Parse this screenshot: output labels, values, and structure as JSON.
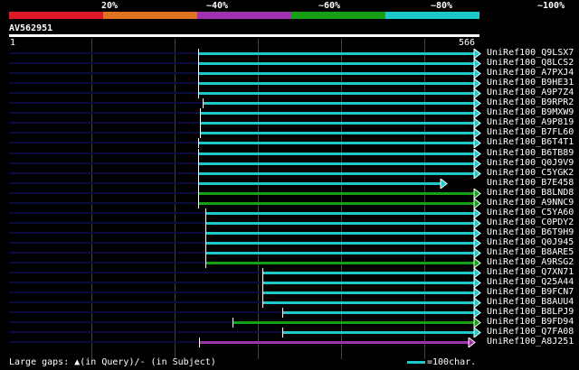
{
  "colors": {
    "scale_red": "#e0192a",
    "scale_orange": "#e0731f",
    "scale_purple": "#a032b0",
    "scale_green": "#16a016",
    "scale_cyan": "#1fc8c8",
    "unaligned": "#0b0b3b",
    "tick": "#444444"
  },
  "scale_labels": [
    "20%",
    "~40%",
    "~60%",
    "~80%",
    "~100%"
  ],
  "query": {
    "id": "AV562951",
    "start": "1",
    "end": "566"
  },
  "hits": [
    {
      "label": "UniRef100_Q9LSX7",
      "color": "cyan"
    },
    {
      "label": "UniRef100_Q8LCS2",
      "color": "cyan"
    },
    {
      "label": "UniRef100_A7PXJ4",
      "color": "cyan"
    },
    {
      "label": "UniRef100_B9HE31",
      "color": "cyan"
    },
    {
      "label": "UniRef100_A9P7Z4",
      "color": "cyan"
    },
    {
      "label": "UniRef100_B9RPR2",
      "color": "cyan"
    },
    {
      "label": "UniRef100_B9MXW9",
      "color": "cyan"
    },
    {
      "label": "UniRef100_A9P819",
      "color": "cyan"
    },
    {
      "label": "UniRef100_B7FL60",
      "color": "cyan"
    },
    {
      "label": "UniRef100_B6T4T1",
      "color": "cyan"
    },
    {
      "label": "UniRef100_B6TB89",
      "color": "cyan"
    },
    {
      "label": "UniRef100_Q0J9V9",
      "color": "cyan"
    },
    {
      "label": "UniRef100_C5YGK2",
      "color": "cyan"
    },
    {
      "label": "UniRef100_B7E458",
      "color": "cyan"
    },
    {
      "label": "UniRef100_B8LND8",
      "color": "green"
    },
    {
      "label": "UniRef100_A9NNC9",
      "color": "green"
    },
    {
      "label": "UniRef100_C5YA60",
      "color": "cyan"
    },
    {
      "label": "UniRef100_C0PDY2",
      "color": "cyan"
    },
    {
      "label": "UniRef100_B6T9H9",
      "color": "cyan"
    },
    {
      "label": "UniRef100_Q0J945",
      "color": "cyan"
    },
    {
      "label": "UniRef100_B8ARE5",
      "color": "cyan"
    },
    {
      "label": "UniRef100_A9RSG2",
      "color": "green"
    },
    {
      "label": "UniRef100_Q7XN71",
      "color": "cyan"
    },
    {
      "label": "UniRef100_Q25A44",
      "color": "cyan"
    },
    {
      "label": "UniRef100_B9FCN7",
      "color": "cyan"
    },
    {
      "label": "UniRef100_B8AUU4",
      "color": "cyan"
    },
    {
      "label": "UniRef100_B8LPJ9",
      "color": "cyan"
    },
    {
      "label": "UniRef100_B9FD94",
      "color": "green"
    },
    {
      "label": "UniRef100_Q7FA08",
      "color": "cyan"
    },
    {
      "label": "UniRef100_A8J251",
      "color": "purple"
    }
  ],
  "footer": {
    "gaps_text": "Large gaps: ▲(in Query)/- (in Subject)",
    "legend_text": "=100char."
  }
}
